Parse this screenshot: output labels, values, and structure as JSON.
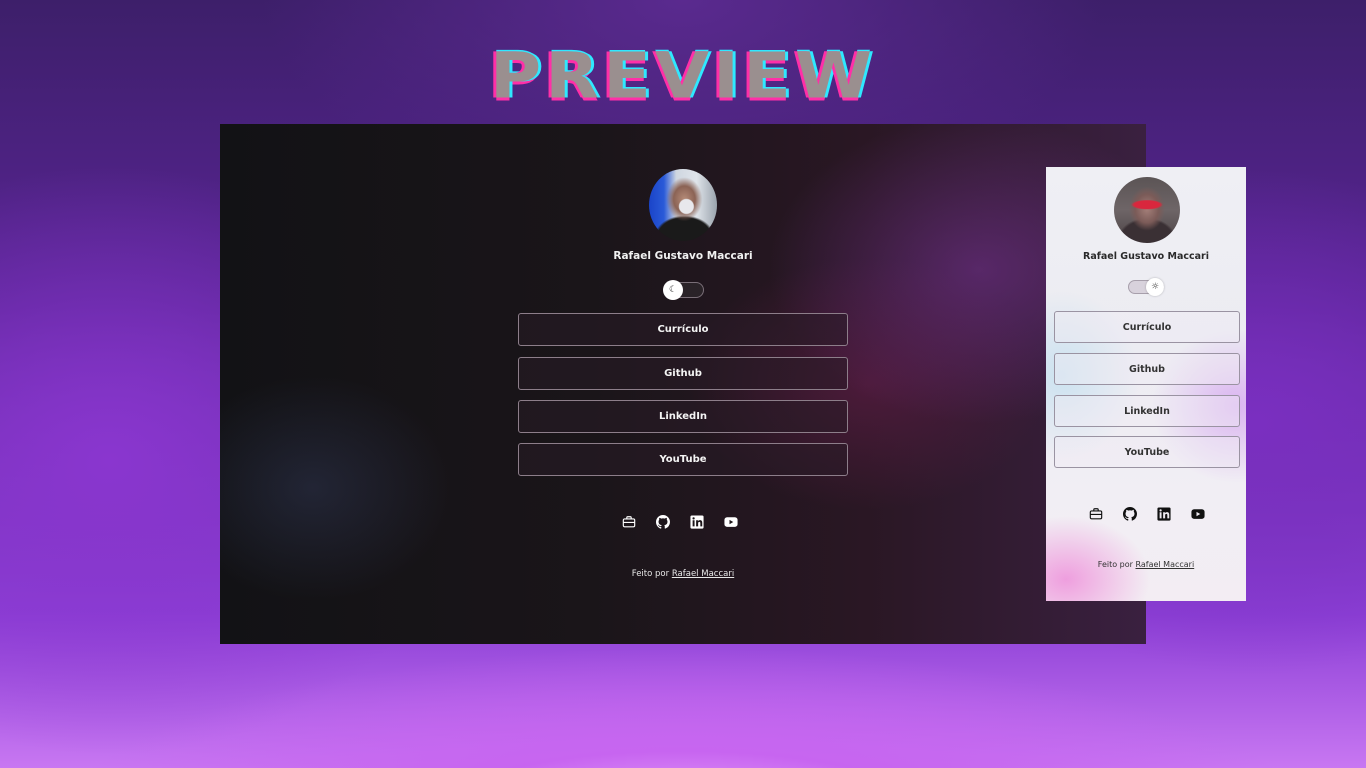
{
  "heading": "PREVIEW",
  "profile": {
    "name": "Rafael Gustavo Maccari"
  },
  "links": [
    {
      "label": "Currículo"
    },
    {
      "label": "Github"
    },
    {
      "label": "LinkedIn"
    },
    {
      "label": "YouTube"
    }
  ],
  "social_icons": [
    "briefcase-icon",
    "github-icon",
    "linkedin-icon",
    "youtube-icon"
  ],
  "toggle": {
    "dark_icon": "☾",
    "light_icon": "☼"
  },
  "footer": {
    "prefix": "Feito por",
    "author": "Rafael Maccari"
  },
  "colors": {
    "title_fill": "#9a8f8f",
    "title_pink": "#ff2fa8",
    "title_cyan": "#2fe8ff"
  }
}
